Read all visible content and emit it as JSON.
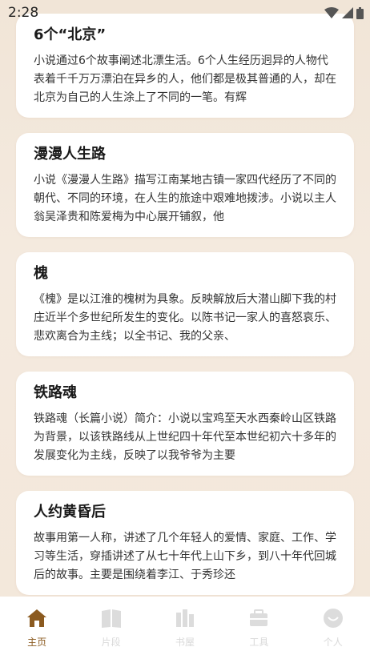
{
  "status_bar": {
    "time": "2:28"
  },
  "books": [
    {
      "title": "6个“北京”",
      "desc": "小说通过6个故事阐述北漂生活。6个人生经历迥异的人物代表着千千万万漂泊在异乡的人，他们都是极其普通的人，却在北京为自己的人生涂上了不同的一笔。有辉"
    },
    {
      "title": "漫漫人生路",
      "desc": "小说《漫漫人生路》描写江南某地古镇一家四代经历了不同的朝代、不同的环境，在人生的旅途中艰难地拨涉。小说以主人翁吴泽贵和陈爱梅为中心展开铺叙，他"
    },
    {
      "title": "槐",
      "desc": "《槐》是以江淮的槐树为具象。反映解放后大潜山脚下我的村庄近半个多世纪所发生的变化。以陈书记一家人的喜怒哀乐、悲欢离合为主线；以全书记、我的父亲、"
    },
    {
      "title": "铁路魂",
      "desc": "铁路魂（长篇小说）简介：小说以宝鸡至天水西秦岭山区铁路为背景，以该铁路线从上世纪四十年代至本世纪初六十多年的发展变化为主线，反映了以我爷爷为主要"
    },
    {
      "title": "人约黄昏后",
      "desc": "故事用第一人称，讲述了几个年轻人的爱情、家庭、工作、学习等生活，穿插讲述了从七十年代上山下乡，到八十年代回城后的故事。主要是围绕着李江、于秀珍还"
    }
  ],
  "tabbar": {
    "items": [
      {
        "label": "主页",
        "icon": "home-icon",
        "active": true
      },
      {
        "label": "片段",
        "icon": "book-icon",
        "active": false
      },
      {
        "label": "书屋",
        "icon": "bookshelf-icon",
        "active": false
      },
      {
        "label": "工具",
        "icon": "toolbox-icon",
        "active": false
      },
      {
        "label": "个人",
        "icon": "person-icon",
        "active": false
      }
    ]
  },
  "colors": {
    "accent": "#8b5a1f",
    "inactive": "#d9d9d9",
    "background": "#f3e7da"
  }
}
